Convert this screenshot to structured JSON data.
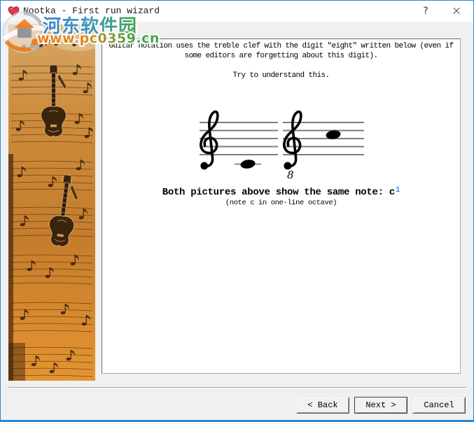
{
  "window": {
    "title": "Nootka - First run wizard",
    "help_label": "?",
    "close_label": "×"
  },
  "watermark": {
    "site_name": "河东软件园",
    "site_url": "www.pc0359.cn"
  },
  "content": {
    "paragraph": "Guitar notation uses the treble clef with the digit \"eight\" written below (even if some editors are forgetting about this digit).",
    "prompt": "Try to understand this.",
    "caption_main": "Both pictures above show the same note: c",
    "caption_superscript": "1",
    "caption_sub": "(note c in one-line octave)",
    "staff_octave_digit": "8"
  },
  "buttons": {
    "back": "< Back",
    "next": "Next >",
    "cancel": "Cancel"
  },
  "colors": {
    "accent": "#2788d8",
    "dialog-bg": "#f0f0f0",
    "titlebar-bg": "#ffffff",
    "panel-bg": "#ffffff",
    "sup": "#3f93ea",
    "staff": "#7d7d7d",
    "wm-blue": "#2f7fd6",
    "wm-green": "#3aa040",
    "wm-orange": "#ef7f1e"
  }
}
